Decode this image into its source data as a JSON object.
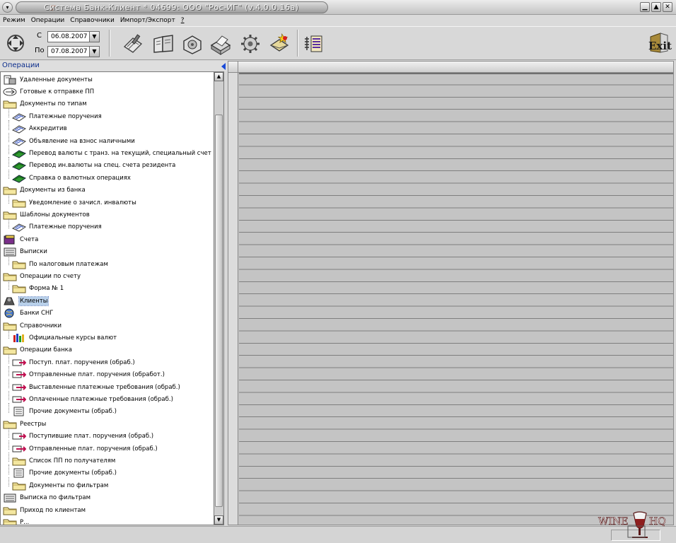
{
  "window": {
    "title": "Система Банк-Клиент * 04699: ООО \"Рос-ИГ\"   (v.4.0.0.16a)",
    "sys_menu_glyph": "▾",
    "minimize": "▁",
    "maximize": "▲",
    "close": "✕"
  },
  "menu": {
    "items": [
      "Режим",
      "Операции",
      "Справочники",
      "Импорт/Экспорт",
      "?"
    ]
  },
  "toolbar": {
    "from_label": "С",
    "from_date": "06.08.2007",
    "to_label": "По",
    "to_date": "07.08.2007",
    "dropdown_glyph": "▼",
    "exit_label": "Exit",
    "icons": [
      "refresh-icon",
      "documents-icon",
      "book-icon",
      "settings-icon",
      "printer-icon",
      "gear-icon",
      "mail-icon",
      "list-icon"
    ]
  },
  "panel": {
    "title": "Операции"
  },
  "tree": {
    "items": [
      {
        "label": "Удаленные документы",
        "level": 0,
        "icon": "deleted-docs-icon"
      },
      {
        "label": "Готовые к отправке ПП",
        "level": 0,
        "icon": "ready-to-send-icon"
      },
      {
        "label": "Документы по типам",
        "level": 0,
        "icon": "folder-icon"
      },
      {
        "label": "Платежные поручения",
        "level": 1,
        "icon": "payment-order-icon"
      },
      {
        "label": "Аккредитив",
        "level": 1,
        "icon": "payment-order-icon"
      },
      {
        "label": "Объявление на взнос наличными",
        "level": 1,
        "icon": "payment-order-icon"
      },
      {
        "label": "Перевод валюты с транз. на текущий, специальный счет",
        "level": 1,
        "icon": "currency-icon"
      },
      {
        "label": "Перевод ин.валюты на спец. счета резидента",
        "level": 1,
        "icon": "currency-icon"
      },
      {
        "label": "Справка о валютных операциях",
        "level": 1,
        "icon": "currency-icon"
      },
      {
        "label": "Документы из банка",
        "level": 0,
        "icon": "folder-icon"
      },
      {
        "label": "Уведомление о зачисл. инвалюты",
        "level": 1,
        "icon": "folder-icon"
      },
      {
        "label": "Шаблоны документов",
        "level": 0,
        "icon": "folder-icon"
      },
      {
        "label": "Платежные поручения",
        "level": 1,
        "icon": "payment-order-icon"
      },
      {
        "label": "Счета",
        "level": 0,
        "icon": "accounts-icon"
      },
      {
        "label": "Выписки",
        "level": 0,
        "icon": "statements-icon"
      },
      {
        "label": "По налоговым платежам",
        "level": 1,
        "icon": "folder-icon"
      },
      {
        "label": "Операции по счету",
        "level": 0,
        "icon": "folder-icon"
      },
      {
        "label": "Форма № 1",
        "level": 1,
        "icon": "folder-icon"
      },
      {
        "label": "Клиенты",
        "level": 0,
        "icon": "clients-icon",
        "selected": true
      },
      {
        "label": "Банки СНГ",
        "level": 0,
        "icon": "banks-icon"
      },
      {
        "label": "Справочники",
        "level": 0,
        "icon": "folder-icon"
      },
      {
        "label": "Официальные курсы валют",
        "level": 1,
        "icon": "rates-icon"
      },
      {
        "label": "Операции банка",
        "level": 0,
        "icon": "folder-icon"
      },
      {
        "label": "Поступ. плат. поручения (обраб.)",
        "level": 1,
        "icon": "incoming-icon"
      },
      {
        "label": "Отправленные плат. поручения (обработ.)",
        "level": 1,
        "icon": "outgoing-icon"
      },
      {
        "label": "Выставленные платежные требования (обраб.)",
        "level": 1,
        "icon": "outgoing-icon"
      },
      {
        "label": "Оплаченные платежные требования (обраб.)",
        "level": 1,
        "icon": "outgoing-icon"
      },
      {
        "label": "Прочие документы (обраб.)",
        "level": 1,
        "icon": "document-icon"
      },
      {
        "label": "Реестры",
        "level": 0,
        "icon": "folder-icon"
      },
      {
        "label": "Поступившие плат. поручения (обраб.)",
        "level": 1,
        "icon": "incoming-icon"
      },
      {
        "label": "Отправленные плат. поручения (обраб.)",
        "level": 1,
        "icon": "outgoing-icon"
      },
      {
        "label": "Список ПП по получателям",
        "level": 1,
        "icon": "folder-icon"
      },
      {
        "label": "Прочие документы (обраб.)",
        "level": 1,
        "icon": "document-icon"
      },
      {
        "label": "Документы по фильтрам",
        "level": 1,
        "icon": "folder-icon"
      },
      {
        "label": "Выписка по фильтрам",
        "level": 0,
        "icon": "statements-icon"
      },
      {
        "label": "Приход по клиентам",
        "level": 0,
        "icon": "folder-icon"
      },
      {
        "label": "Р...",
        "level": 0,
        "icon": "folder-icon"
      }
    ]
  },
  "scrollbar": {
    "up_glyph": "▲",
    "down_glyph": "▼"
  },
  "watermark": {
    "text_left": "WINE",
    "text_right": "HQ"
  }
}
